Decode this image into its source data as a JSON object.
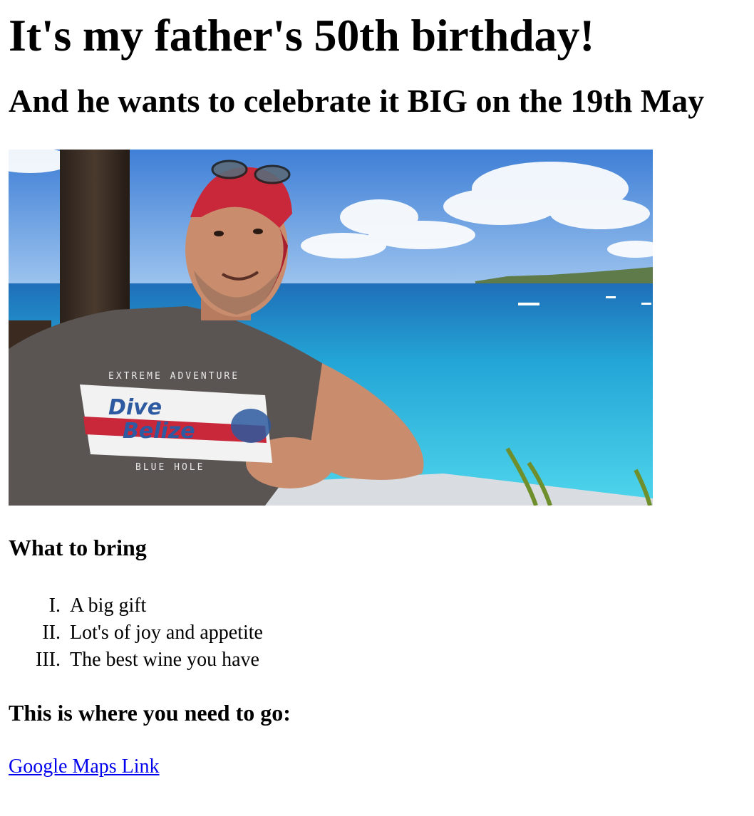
{
  "page": {
    "title": "It's my father's 50th birthday!",
    "subtitle": "And he wants to celebrate it BIG on the 19th May"
  },
  "photo": {
    "shirt_top": "EXTREME ADVENTURE",
    "shirt_brand_1": "Dive",
    "shirt_brand_2": "Belize",
    "shirt_bottom": "BLUE HOLE"
  },
  "bring": {
    "heading": "What to bring",
    "items": [
      "A big gift",
      "Lot's of joy and appetite",
      "The best wine you have"
    ]
  },
  "location": {
    "heading": "This is where you need to go:",
    "link_label": "Google Maps Link"
  },
  "colors": {
    "link": "#0000ee",
    "sky": "#4a86d8",
    "sea": "#2fb4d8",
    "cap": "#c8283a",
    "shirt": "#5a5552"
  }
}
